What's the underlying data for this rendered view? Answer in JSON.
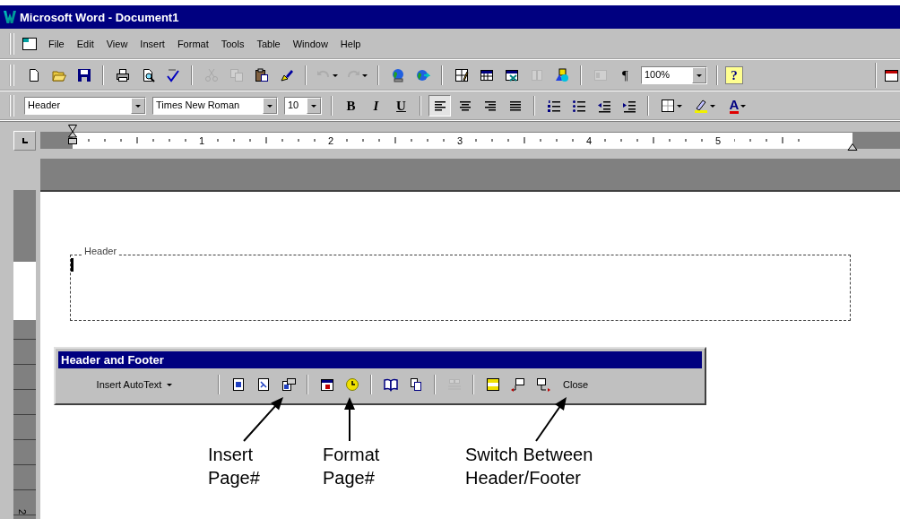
{
  "window": {
    "title": "Microsoft Word - Document1"
  },
  "menu": [
    "File",
    "Edit",
    "View",
    "Insert",
    "Format",
    "Tools",
    "Table",
    "Window",
    "Help"
  ],
  "standard_toolbar": [
    {
      "kind": "new",
      "disabled": false
    },
    {
      "kind": "open",
      "disabled": false
    },
    {
      "kind": "save",
      "disabled": false
    },
    {
      "kind": "separator"
    },
    {
      "kind": "print",
      "disabled": false
    },
    {
      "kind": "preview",
      "disabled": false
    },
    {
      "kind": "spell",
      "disabled": false
    },
    {
      "kind": "separator"
    },
    {
      "kind": "cut",
      "disabled": true
    },
    {
      "kind": "copy",
      "disabled": true
    },
    {
      "kind": "paste",
      "disabled": false
    },
    {
      "kind": "brush",
      "disabled": false
    },
    {
      "kind": "separator"
    },
    {
      "kind": "undo",
      "disabled": true
    },
    {
      "kind": "redo",
      "disabled": true
    },
    {
      "kind": "separator"
    },
    {
      "kind": "globe",
      "disabled": false
    },
    {
      "kind": "globe-link",
      "disabled": false
    },
    {
      "kind": "separator"
    },
    {
      "kind": "tables-borders",
      "disabled": false
    },
    {
      "kind": "table",
      "disabled": false
    },
    {
      "kind": "sheet",
      "disabled": false
    },
    {
      "kind": "columns",
      "disabled": true
    },
    {
      "kind": "drawing",
      "disabled": false
    },
    {
      "kind": "separator"
    },
    {
      "kind": "docmap",
      "disabled": true
    },
    {
      "kind": "pilcrow",
      "label": "¶",
      "disabled": false
    },
    {
      "kind": "zoom",
      "value": "100%"
    },
    {
      "kind": "separator"
    },
    {
      "kind": "help",
      "label": "?",
      "disabled": false
    }
  ],
  "formatting_toolbar": [
    {
      "kind": "style",
      "value": "Header"
    },
    {
      "kind": "font",
      "value": "Times New Roman"
    },
    {
      "kind": "size",
      "value": "10"
    },
    {
      "kind": "separator"
    },
    {
      "kind": "bold",
      "label": "B",
      "pressed": false
    },
    {
      "kind": "italic",
      "label": "I",
      "pressed": false
    },
    {
      "kind": "underline",
      "label": "U",
      "pressed": false
    },
    {
      "kind": "separator"
    },
    {
      "kind": "align-left",
      "pressed": true
    },
    {
      "kind": "align-center",
      "pressed": false
    },
    {
      "kind": "align-right",
      "pressed": false
    },
    {
      "kind": "justify",
      "pressed": false
    },
    {
      "kind": "separator"
    },
    {
      "kind": "numbering",
      "pressed": false
    },
    {
      "kind": "bullets",
      "pressed": false
    },
    {
      "kind": "outdent",
      "pressed": false
    },
    {
      "kind": "indent",
      "pressed": false
    },
    {
      "kind": "separator"
    },
    {
      "kind": "border",
      "pressed": false
    },
    {
      "kind": "highlight",
      "pressed": false
    },
    {
      "kind": "font-color",
      "label": "A",
      "pressed": false
    }
  ],
  "ruler": {
    "labels": [
      "1",
      "2",
      "3",
      "4",
      "5"
    ]
  },
  "vertical_ruler": {
    "label": "2"
  },
  "document": {
    "header_label": "Header"
  },
  "header_footer_toolbar": {
    "title": "Header and Footer",
    "items": [
      {
        "kind": "autotext",
        "label": "Insert AutoText"
      },
      {
        "kind": "separator"
      },
      {
        "kind": "page-number",
        "disabled": false
      },
      {
        "kind": "page-count",
        "disabled": false
      },
      {
        "kind": "format-page-number",
        "disabled": false
      },
      {
        "kind": "separator"
      },
      {
        "kind": "date",
        "disabled": false
      },
      {
        "kind": "time",
        "disabled": false
      },
      {
        "kind": "separator"
      },
      {
        "kind": "page-setup",
        "disabled": false
      },
      {
        "kind": "show-hide",
        "disabled": false
      },
      {
        "kind": "separator"
      },
      {
        "kind": "same-previous",
        "disabled": true
      },
      {
        "kind": "separator"
      },
      {
        "kind": "switch",
        "disabled": false
      },
      {
        "kind": "previous",
        "disabled": false
      },
      {
        "kind": "next",
        "disabled": false
      },
      {
        "kind": "close",
        "label": "Close"
      }
    ]
  },
  "annotations": [
    {
      "lines": [
        "Insert",
        "Page#"
      ]
    },
    {
      "lines": [
        "Format",
        "Page#"
      ]
    },
    {
      "lines": [
        "Switch Between",
        "Header/Footer"
      ]
    }
  ]
}
